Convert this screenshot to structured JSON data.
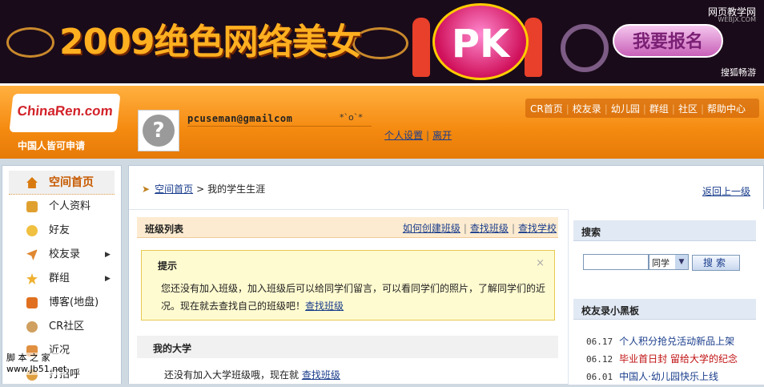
{
  "banner": {
    "title": "2009绝色网络美女",
    "pk_text": "PK",
    "signup": "我要报名",
    "site_name": "网页教学网",
    "site_sub": "WEBJX.COM",
    "brand": "搜狐畅游"
  },
  "header": {
    "logo": "ChinaRen.com",
    "slogan": "中国人皆可申请",
    "avatar_glyph": "?",
    "email": "pcuseman@gmailcom",
    "emoticon": "*`o`*",
    "links": [
      "个人设置",
      "离开"
    ],
    "nav": [
      "CR首页",
      "校友录",
      "幼儿园",
      "群组",
      "社区",
      "帮助中心"
    ]
  },
  "sidebar": {
    "items": [
      {
        "label": "空间首页",
        "icon": "home-icon",
        "color": "#d97a10"
      },
      {
        "label": "个人资料",
        "icon": "profile-card-icon",
        "color": "#e0a030"
      },
      {
        "label": "好友",
        "icon": "friend-icon",
        "color": "#f0c040"
      },
      {
        "label": "校友录",
        "icon": "paper-plane-icon",
        "color": "#e08830",
        "arrow": "▶"
      },
      {
        "label": "群组",
        "icon": "group-star-icon",
        "color": "#f0b030",
        "arrow": "▶"
      },
      {
        "label": "博客(地盘)",
        "icon": "blog-icon",
        "color": "#e07020"
      },
      {
        "label": "CR社区",
        "icon": "community-icon",
        "color": "#d0a060"
      },
      {
        "label": "近况",
        "icon": "status-icon",
        "color": "#e09040"
      },
      {
        "label": "打招呼",
        "icon": "greet-icon",
        "color": "#e0a040"
      }
    ]
  },
  "main": {
    "crumb_home": "空间首页",
    "crumb_sep": ">",
    "crumb_current": "我的学生生涯",
    "back": "返回上一级",
    "class_title": "班级列表",
    "class_links": [
      "如何创建班级",
      "查找班级",
      "查找学校"
    ],
    "tip_title": "提示",
    "tip_close": "×",
    "tip_body": "您还没有加入班级，加入班级后可以给同学们留言，可以看同学们的照片，了解同学们的近况。现在就去查找自己的班级吧！",
    "tip_link": "查找班级",
    "uni_title": "我的大学",
    "uni_body": "还没有加入大学班级哦，现在就",
    "uni_link": "查找班级"
  },
  "right": {
    "search_title": "搜索",
    "search_value": "",
    "search_select": "同学",
    "search_button": "搜索",
    "board_title": "校友录小黑板",
    "board_items": [
      {
        "date": "06.17",
        "text": "个人积分抢兑活动新品上架",
        "color": "#1a3d8c"
      },
      {
        "date": "06.12",
        "text": "毕业首日封 留给大学的纪念",
        "color": "#c01010"
      },
      {
        "date": "06.01",
        "text": "中国人·幼儿园快乐上线",
        "color": "#1a3d8c"
      }
    ]
  },
  "watermark": {
    "line1": "脚 本 之 家",
    "line2": "www.Jb51.net"
  }
}
